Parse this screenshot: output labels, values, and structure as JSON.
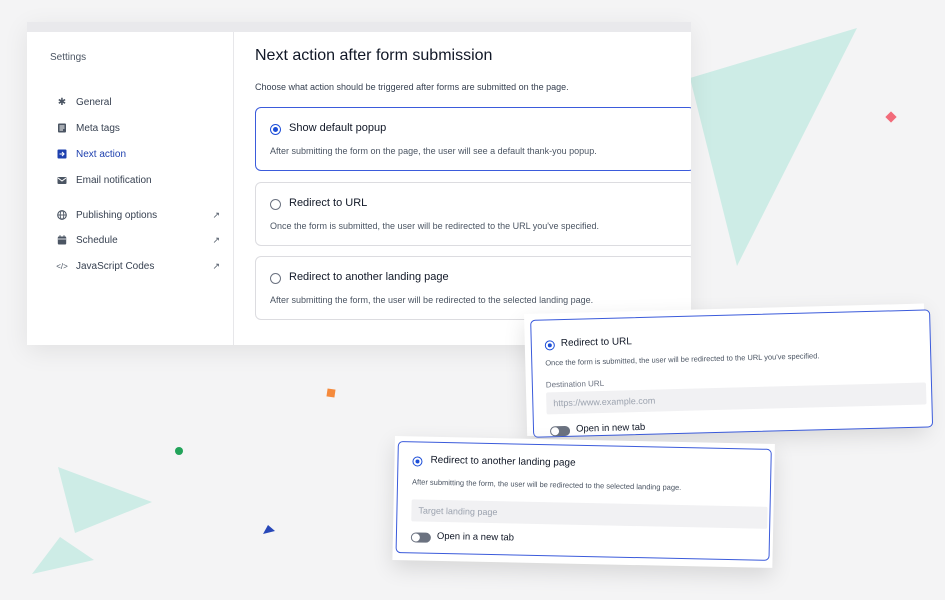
{
  "sidebar": {
    "title": "Settings",
    "items": [
      {
        "label": "General",
        "icon": "gear-icon"
      },
      {
        "label": "Meta tags",
        "icon": "document-icon"
      },
      {
        "label": "Next action",
        "icon": "arrow-right-box-icon",
        "active": true
      },
      {
        "label": "Email notification",
        "icon": "envelope-icon"
      },
      {
        "label": "Publishing options",
        "icon": "globe-icon",
        "external": true
      },
      {
        "label": "Schedule",
        "icon": "calendar-icon",
        "external": true
      },
      {
        "label": "JavaScript Codes",
        "icon": "code-icon",
        "external": true
      }
    ]
  },
  "main": {
    "title": "Next action after form submission",
    "subtitle": "Choose what action should be triggered after forms are submitted on the page.",
    "options": [
      {
        "title": "Show default popup",
        "desc": "After submitting the form on the page, the user will see a default thank-you popup.",
        "selected": true
      },
      {
        "title": "Redirect to URL",
        "desc": "Once the form is submitted, the user will be redirected to the URL you've specified.",
        "selected": false
      },
      {
        "title": "Redirect to another landing page",
        "desc": "After submitting the form, the user will be redirected to the selected landing page.",
        "selected": false
      }
    ]
  },
  "card_url": {
    "title": "Redirect to URL",
    "desc": "Once the form is submitted, the user will be redirected to the URL you've specified.",
    "field_label": "Destination URL",
    "placeholder": "https://www.example.com",
    "toggle_label": "Open in new tab"
  },
  "card_landing": {
    "title": "Redirect to another landing page",
    "desc": "After submitting the form, the user will be redirected to the selected landing page.",
    "placeholder": "Target landing page",
    "toggle_label": "Open in a new tab"
  },
  "colors": {
    "accent": "#1d4ed8",
    "teal": "#c8ebe4",
    "pink": "#f26b7a",
    "orange": "#f58a3c",
    "green": "#22a35a",
    "blue": "#2747b8"
  }
}
